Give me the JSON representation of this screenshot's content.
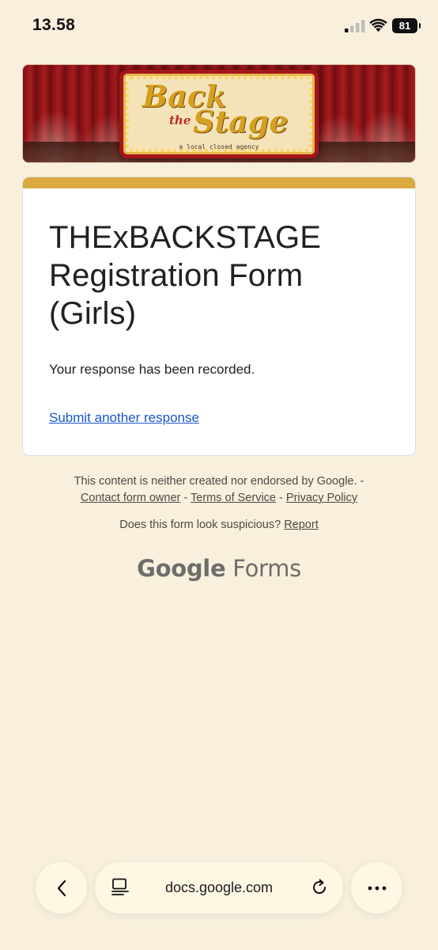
{
  "status_bar": {
    "time": "13.58",
    "battery": "81"
  },
  "banner": {
    "logo_back": "Back",
    "logo_the": "the",
    "logo_stage": "Stage",
    "tagline": "a local closed agency"
  },
  "form": {
    "title": "THExBACKSTAGE Registration Form (Girls)",
    "confirmation": "Your response has been recorded.",
    "submit_another": "Submit another response",
    "accent_color": "#daa93f"
  },
  "footer": {
    "disclaimer": "This content is neither created nor endorsed by Google. -",
    "contact_owner": "Contact form owner",
    "sep1": "-",
    "terms": "Terms of Service",
    "sep2": "-",
    "privacy": "Privacy Policy",
    "suspicious_q": "Does this form look suspicious?",
    "report": "Report",
    "brand_google": "Google",
    "brand_forms": "Forms"
  },
  "browser": {
    "url": "docs.google.com",
    "icons": [
      "back-chevron-icon",
      "reader-mode-icon",
      "reload-icon",
      "more-icon"
    ]
  }
}
